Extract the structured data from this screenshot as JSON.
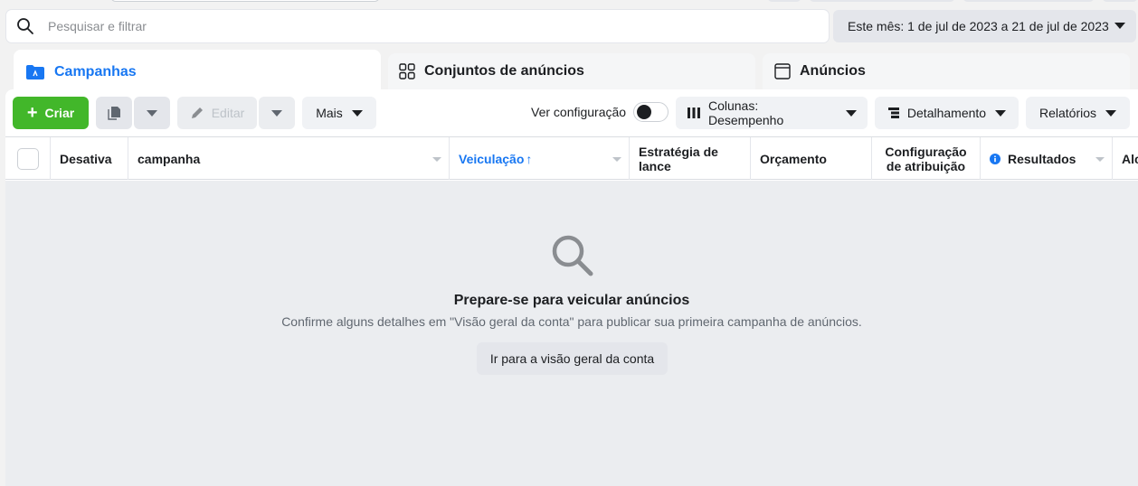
{
  "search": {
    "placeholder": "Pesquisar e filtrar"
  },
  "date_range": {
    "label": "Este mês: 1 de jul de 2023 a 21 de jul de 2023"
  },
  "tabs": [
    {
      "label": "Campanhas",
      "icon": "folder-icon",
      "active": true
    },
    {
      "label": "Conjuntos de anúncios",
      "icon": "grid-icon",
      "active": false
    },
    {
      "label": "Anúncios",
      "icon": "ad-window-icon",
      "active": false
    }
  ],
  "toolbar": {
    "create_label": "Criar",
    "edit_label": "Editar",
    "more_label": "Mais",
    "view_config_label": "Ver configuração",
    "columns_label": "Colunas: Desempenho",
    "breakdown_label": "Detalhamento",
    "reports_label": "Relatórios"
  },
  "table": {
    "columns": [
      "Desativa",
      "campanha",
      "Veiculação",
      "Estratégia de lance",
      "Orçamento",
      "Configuração de atribuição",
      "Resultados",
      "Alc"
    ],
    "sort_arrow": "↑"
  },
  "empty_state": {
    "title": "Prepare-se para veicular anúncios",
    "subtitle": "Confirme alguns detalhes em \"Visão geral da conta\" para publicar sua primeira campanha de anúncios.",
    "button_label": "Ir para a visão geral da conta"
  },
  "colors": {
    "accent": "#1877f2",
    "create_green": "#42b72a",
    "empty_bg": "#ebedf0"
  }
}
